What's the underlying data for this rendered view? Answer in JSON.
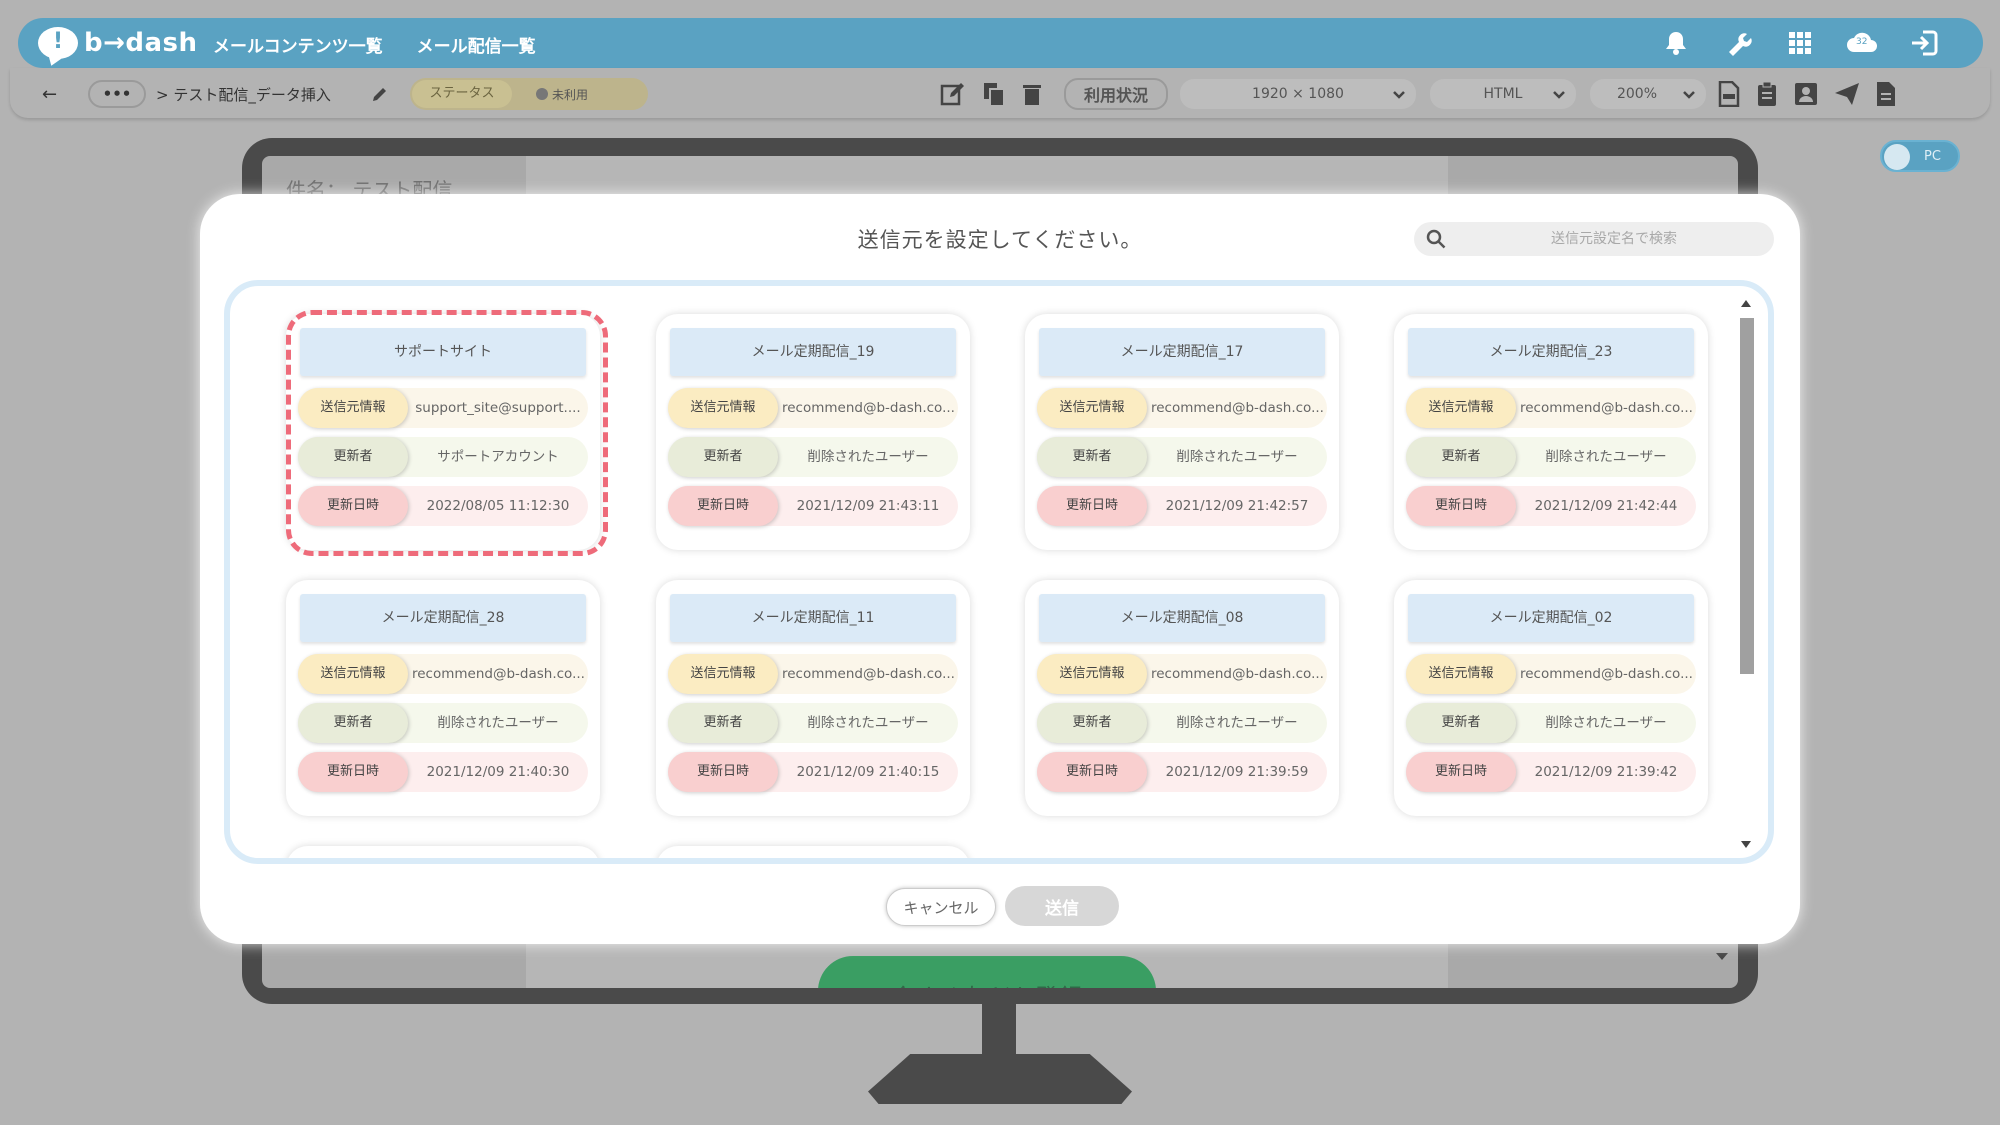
{
  "header": {
    "logo_mark": "!",
    "logo_text": "b→dash",
    "nav": [
      "メールコンテンツ一覧",
      "メール配信一覧"
    ],
    "icons": [
      "bell-icon",
      "wrench-icon",
      "apps-grid-icon",
      "cloud-icon",
      "logout-icon"
    ],
    "cloud_label": "32"
  },
  "toolbar": {
    "back": "←",
    "more": "•••",
    "breadcrumb": "> テスト配信_データ挿入",
    "status_label": "ステータス",
    "status_value": "未利用",
    "usage_label": "利用状況",
    "resolution": "1920 × 1080",
    "format": "HTML",
    "zoom": "200%"
  },
  "preview": {
    "subject": "件名： テスト配信",
    "cta": "今すぐ友だち登録",
    "device_toggle": "PC"
  },
  "modal": {
    "title": "送信元を設定してください。",
    "search_placeholder": "送信元設定名で検索",
    "labels": {
      "sender": "送信元情報",
      "updater": "更新者",
      "updated_at": "更新日時"
    },
    "cards": [
      {
        "name": "サポートサイト",
        "sender": "support_site@support....",
        "updater": "サポートアカウント",
        "updated_at": "2022/08/05 11:12:30",
        "selected": true
      },
      {
        "name": "メール定期配信_19",
        "sender": "recommend@b-dash.co....",
        "updater": "削除されたユーザー",
        "updated_at": "2021/12/09 21:43:11"
      },
      {
        "name": "メール定期配信_17",
        "sender": "recommend@b-dash.co....",
        "updater": "削除されたユーザー",
        "updated_at": "2021/12/09 21:42:57"
      },
      {
        "name": "メール定期配信_23",
        "sender": "recommend@b-dash.co....",
        "updater": "削除されたユーザー",
        "updated_at": "2021/12/09 21:42:44"
      },
      {
        "name": "メール定期配信_28",
        "sender": "recommend@b-dash.co....",
        "updater": "削除されたユーザー",
        "updated_at": "2021/12/09 21:40:30"
      },
      {
        "name": "メール定期配信_11",
        "sender": "recommend@b-dash.co....",
        "updater": "削除されたユーザー",
        "updated_at": "2021/12/09 21:40:15"
      },
      {
        "name": "メール定期配信_08",
        "sender": "recommend@b-dash.co....",
        "updater": "削除されたユーザー",
        "updated_at": "2021/12/09 21:39:59"
      },
      {
        "name": "メール定期配信_02",
        "sender": "recommend@b-dash.co....",
        "updater": "削除されたユーザー",
        "updated_at": "2021/12/09 21:39:42"
      }
    ],
    "cancel_label": "キャンセル",
    "send_label": "送信"
  },
  "colors": {
    "brand": "#5aa2c2",
    "highlight": "#ee6b7a",
    "cta": "#3a9e63"
  }
}
